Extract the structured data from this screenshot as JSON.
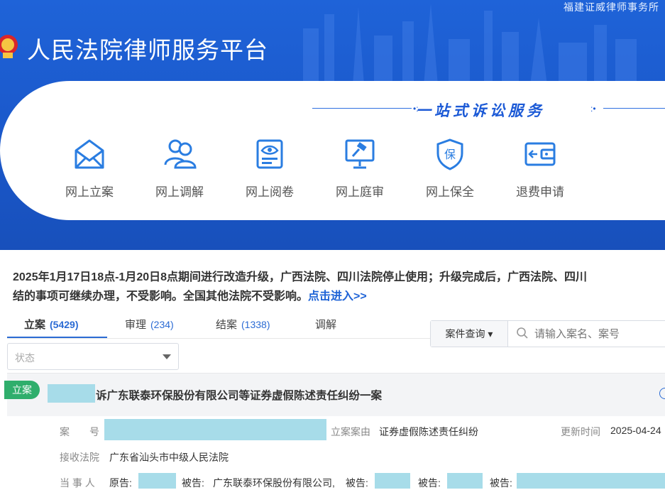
{
  "header": {
    "firm_name": "福建证威律师事务所",
    "site_title": "人民法院律师服务平台",
    "slogan": "一站式诉讼服务"
  },
  "services": [
    {
      "label": "网上立案",
      "icon": "envelope-icon"
    },
    {
      "label": "网上调解",
      "icon": "people-icon"
    },
    {
      "label": "网上阅卷",
      "icon": "document-icon"
    },
    {
      "label": "网上庭审",
      "icon": "gavel-monitor-icon"
    },
    {
      "label": "网上保全",
      "icon": "shield-icon",
      "icon_text": "保"
    },
    {
      "label": "退费申请",
      "icon": "wallet-icon"
    }
  ],
  "notice": {
    "line1": "2025年1月17日18点-1月20日8点期间进行改造升级，广西法院、四川法院停止使用；升级完成后，广西法院、四川",
    "line2": "结的事项可继续办理，不受影响。全国其他法院不受影响。",
    "link": "点击进入>>"
  },
  "tabs": [
    {
      "label": "立案",
      "count": "(5429)",
      "active": true
    },
    {
      "label": "审理",
      "count": "(234)",
      "active": false
    },
    {
      "label": "结案",
      "count": "(1338)",
      "active": false
    },
    {
      "label": "调解",
      "count": "",
      "active": false
    }
  ],
  "query": {
    "select_label": "案件查询",
    "placeholder": "请输入案名、案号"
  },
  "status_filter": {
    "placeholder": "状态"
  },
  "case": {
    "tag": "立案",
    "title": "诉广东联泰环保股份有限公司等证券虚假陈述责任纠纷一案",
    "case_no_label": "案　　号",
    "reason_label": "立案案由",
    "reason_value": "证券虚假陈述责任纠纷",
    "updated_label": "更新时间",
    "updated_value": "2025-04-24",
    "court_label": "接收法院",
    "court_value": "广东省汕头市中级人民法院",
    "party_label": "当 事 人",
    "plaintiff_label": "原告:",
    "defendant_label": "被告:",
    "defendant_1": "广东联泰环保股份有限公司,"
  },
  "colors": {
    "primary": "#1f63d8",
    "accent": "#2b6bd4",
    "tag_green": "#2fae6c",
    "mask": "#a7dce9"
  }
}
